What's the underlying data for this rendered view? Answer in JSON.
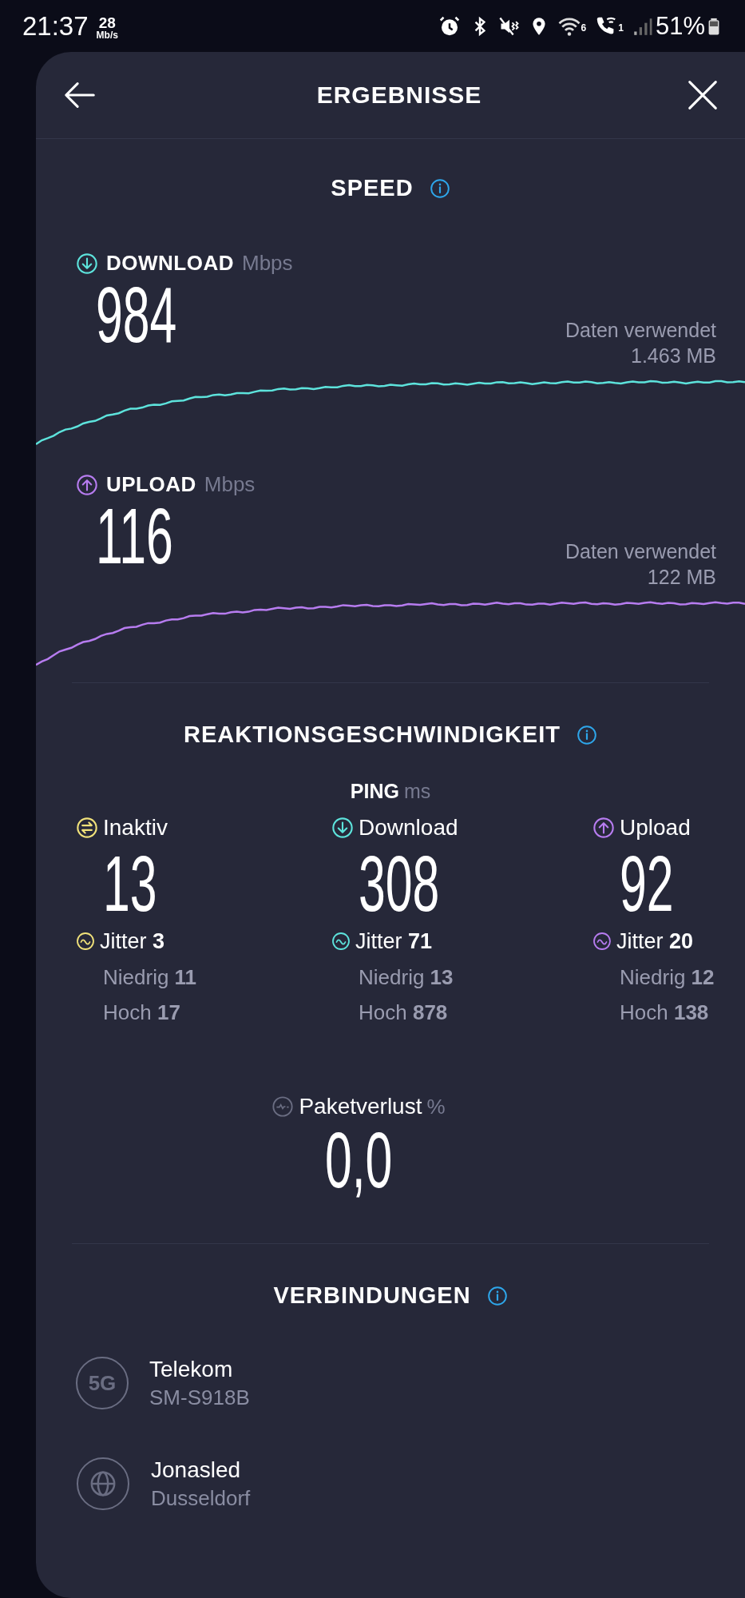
{
  "status_bar": {
    "time": "21:37",
    "net_speed": "28",
    "net_unit": "Mb/s",
    "wifi_badge": "6",
    "call_badge": "1",
    "battery": "51%"
  },
  "header": {
    "title": "ERGEBNISSE"
  },
  "speed": {
    "title": "SPEED",
    "tests": [
      {
        "kind": "download",
        "label": "DOWNLOAD",
        "unit": "Mbps",
        "value": "984",
        "data_label": "Daten verwendet",
        "data_value": "1.463 MB",
        "color": "#5de3dc"
      },
      {
        "kind": "upload",
        "label": "UPLOAD",
        "unit": "Mbps",
        "value": "116",
        "data_label": "Daten verwendet",
        "data_value": "122 MB",
        "color": "#b77cf0"
      }
    ]
  },
  "responsiveness": {
    "title": "REAKTIONSGESCHWINDIGKEIT",
    "ping_label": "PING",
    "ping_unit": "ms",
    "columns": [
      {
        "kind": "idle",
        "label": "Inaktiv",
        "value": "13",
        "jitter": "Jitter **3**",
        "low": "Niedrig **11**",
        "high": "Hoch **17**",
        "color": "#f1e27a"
      },
      {
        "kind": "download",
        "label": "Download",
        "value": "308",
        "jitter": "Jitter **71**",
        "low": "Niedrig **13**",
        "high": "Hoch **878**",
        "color": "#5de3dc"
      },
      {
        "kind": "upload",
        "label": "Upload",
        "value": "92",
        "jitter": "Jitter **20**",
        "low": "Niedrig **12**",
        "high": "Hoch **138**",
        "color": "#b77cf0"
      }
    ],
    "packet_loss": {
      "label": "Paketverlust",
      "unit": "%",
      "value": "0,0"
    }
  },
  "connections": {
    "title": "VERBINDUNGEN",
    "items": [
      {
        "kind": "network",
        "badge": "5G",
        "name": "Telekom",
        "detail": "SM-S918B"
      },
      {
        "kind": "server",
        "name": "Jonasled",
        "detail": "Dusseldorf"
      }
    ]
  }
}
